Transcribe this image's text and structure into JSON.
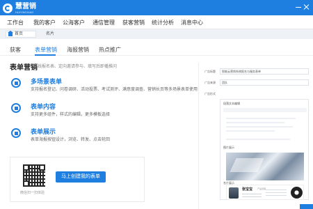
{
  "app": {
    "name": "慧营销",
    "subtitle": "HUIYINGXIAO"
  },
  "mainnav": [
    {
      "label": "工作台"
    },
    {
      "label": "我的客户"
    },
    {
      "label": "公海客户"
    },
    {
      "label": "通信管理"
    },
    {
      "label": "获客营销"
    },
    {
      "label": "统计分析"
    },
    {
      "label": "消息中心"
    }
  ],
  "tabs": {
    "home": "首页",
    "card": "名片"
  },
  "subtabs": [
    {
      "label": "获客"
    },
    {
      "label": "表单营销"
    },
    {
      "label": "海报营销"
    },
    {
      "label": "热点推广"
    }
  ],
  "section": {
    "title": "表单营销",
    "desc": "在线报名表、定向邀请参与、填写后即播推问"
  },
  "features": [
    {
      "title": "多场景表单",
      "desc": "支持报名登记、问卷调研、活动投票、考试测评、满意度调查、营销长页等多场景表单使用",
      "icon": "form-scene-icon"
    },
    {
      "title": "表单内容",
      "desc": "支持更多组件，样式的编辑，更多模板选择",
      "icon": "form-content-icon"
    },
    {
      "title": "表单展示",
      "desc": "表单海报按钮设计，浏览、转发、点击轮回",
      "icon": "form-display-icon"
    }
  ],
  "qr": {
    "caption": "微信扫一扫体验",
    "button": "马上创建我的表单"
  },
  "panel": {
    "fields": [
      {
        "label": "广告标题",
        "value": "智能云营销系统报名与服务表单"
      },
      {
        "label": "广告来源",
        "value": "团队"
      },
      {
        "label": "广告形式",
        "value": ""
      }
    ],
    "editor_head": "段落文本编辑",
    "img_label": "图片展示",
    "card_label": "名片展示",
    "card": {
      "name": "张宝宝",
      "role": "产品经理"
    }
  },
  "colors": {
    "brand": "#1f7fe0",
    "nav_bg": "#ffffff",
    "tabstrip": "#eef1f5"
  }
}
